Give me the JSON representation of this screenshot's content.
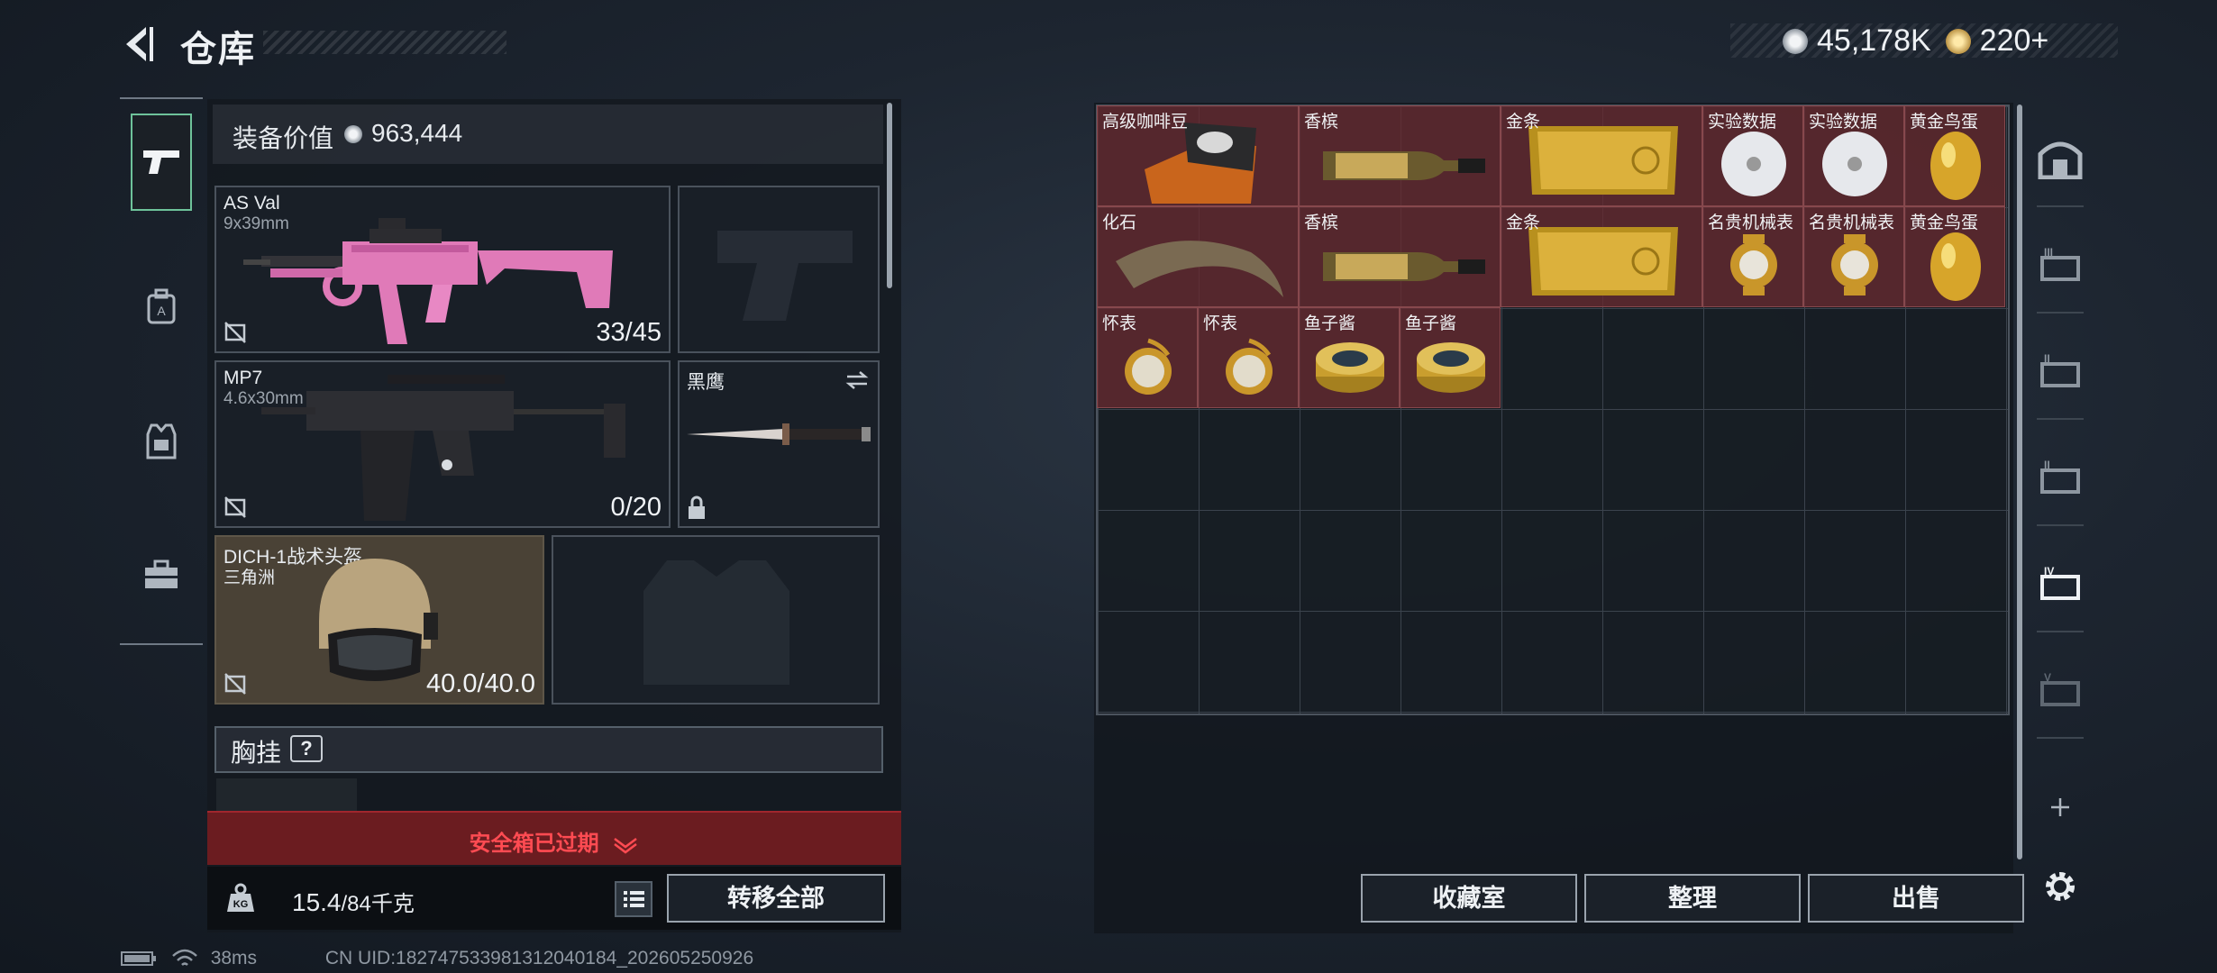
{
  "header": {
    "title": "仓库",
    "silver_value": "45,178K",
    "gold_value": "220+"
  },
  "equipment": {
    "value_label": "装备价值",
    "value": "963,444",
    "primary_weapon": {
      "name": "AS Val",
      "ammo": "9x39mm",
      "count": "33/45"
    },
    "secondary_weapon": {
      "name": "MP7",
      "ammo": "4.6x30mm",
      "count": "0/20"
    },
    "melee": {
      "name": "黑鹰"
    },
    "helmet": {
      "name": "DICH-1战术头盔",
      "sub": "三角洲",
      "durability": "40.0/40.0"
    },
    "chest_rig_label": "胸挂",
    "help": "?"
  },
  "safebox": {
    "text": "安全箱已过期"
  },
  "footer": {
    "weight": "15.4",
    "capacity": "/84千克",
    "transfer_label": "转移全部"
  },
  "status_bar": {
    "ping": "38ms",
    "uid": "CN UID:1827475339813120401​84_202605250926"
  },
  "storage": {
    "items": [
      {
        "name": "高级咖啡豆"
      },
      {
        "name": "香槟"
      },
      {
        "name": "金条"
      },
      {
        "name": "实验数据"
      },
      {
        "name": "实验数据"
      },
      {
        "name": "黄金鸟蛋"
      },
      {
        "name": "化石"
      },
      {
        "name": "香槟"
      },
      {
        "name": "金条"
      },
      {
        "name": "名贵机械表"
      },
      {
        "name": "名贵机械表"
      },
      {
        "name": "黄金鸟蛋"
      },
      {
        "name": "怀表"
      },
      {
        "name": "怀表"
      },
      {
        "name": "鱼子酱"
      },
      {
        "name": "鱼子酱"
      }
    ],
    "buttons": {
      "collection": "收藏室",
      "organize": "整理",
      "sell": "出售"
    }
  },
  "icons": [
    "back-arrow-icon",
    "silver-coin-icon",
    "gold-coin-icon",
    "pistol-icon",
    "backpack-icon",
    "vest-icon",
    "toolbox-icon",
    "weight-icon",
    "list-icon",
    "no-link-icon",
    "lock-icon",
    "swap-icon",
    "chevron-down-icon",
    "battery-icon",
    "wifi-icon",
    "stash-icon",
    "gear-icon",
    "plus-icon"
  ],
  "colors": {
    "accent_green": "#6ec29a",
    "item_bg": "#662a30",
    "safebox_red": "#ff4b52"
  }
}
